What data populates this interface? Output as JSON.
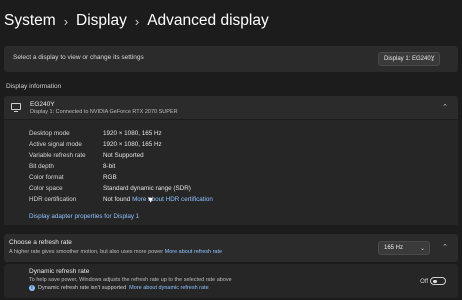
{
  "breadcrumb": [
    "System",
    "Display",
    "Advanced display"
  ],
  "breadcrumb_separator": "›",
  "select_display": {
    "label": "Select a display to view or change its settings",
    "value": "Display 1: EG240Y"
  },
  "section_title": "Display information",
  "display": {
    "name": "EG240Y",
    "subtitle": "Display 1: Connected to NVIDIA GeForce RTX 2070 SUPER",
    "rows": [
      {
        "key": "Desktop mode",
        "value": "1920 × 1080, 165 Hz"
      },
      {
        "key": "Active signal mode",
        "value": "1920 × 1080, 165 Hz"
      },
      {
        "key": "Variable refresh rate",
        "value": "Not Supported"
      },
      {
        "key": "Bit depth",
        "value": "8-bit"
      },
      {
        "key": "Color format",
        "value": "RGB"
      },
      {
        "key": "Color space",
        "value": "Standard dynamic range (SDR)"
      },
      {
        "key": "HDR certification",
        "value": "Not found",
        "link": "More about HDR certification"
      }
    ],
    "adapter_link": "Display adapter properties for Display 1"
  },
  "refresh_rate": {
    "title": "Choose a refresh rate",
    "subtitle": "A higher rate gives smoother motion, but also uses more power",
    "link": "More about refresh rate",
    "value": "165 Hz"
  },
  "dynamic_refresh": {
    "title": "Dynamic refresh rate",
    "subtitle": "To help save power, Windows adjusts the refresh rate up to the selected rate above",
    "note": "Dynamic refresh rate isn't supported",
    "note_link": "More about dynamic refresh rate",
    "toggle_label": "Off"
  },
  "colors": {
    "background": "#1c1c1c",
    "card": "#2b2b2b",
    "link": "#8fc3ff"
  },
  "icons": [
    "chevron-right-icon",
    "chevron-down-icon",
    "monitor-icon",
    "chevron-up-icon",
    "info-icon"
  ]
}
